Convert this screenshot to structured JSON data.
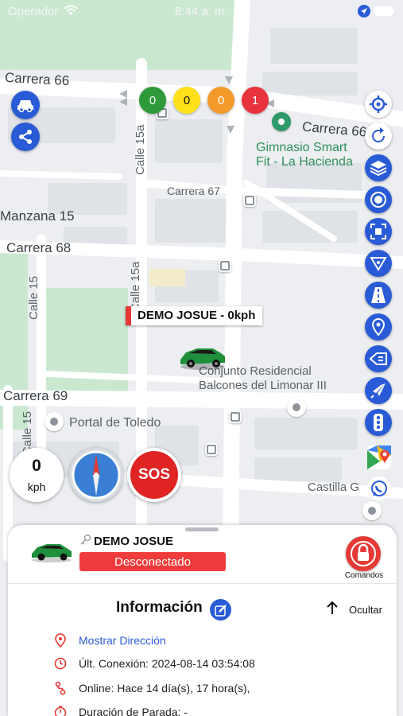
{
  "status_bar": {
    "operator": "Operador",
    "time": "8:44 a. m."
  },
  "map": {
    "streets": {
      "carrera_66_left": "Carrera 66",
      "carrera_66_right": "Carrera 66",
      "carrera_67": "Carrera 67",
      "carrera_68": "Carrera 68",
      "carrera_69": "Carrera 69",
      "calle_15a_top": "Calle 15a",
      "calle_15a_mid": "Calle 15a",
      "calle_15_left": "Calle 15",
      "calle_15_bottom": "Calle 15",
      "manzana_15": "Manzana 15"
    },
    "places": {
      "gym_line1": "Gimnasio Smart",
      "gym_line2": "Fit - La Hacienda",
      "conjunto_line1": "Conjunto Residencial",
      "conjunto_line2": "Balcones del Limonar III",
      "portal": "Portal de Toledo",
      "castilla": "Castilla G"
    }
  },
  "status_counters": [
    {
      "value": "0",
      "color": "#2e9a3a"
    },
    {
      "value": "0",
      "color": "#ffe11a"
    },
    {
      "value": "0",
      "color": "#f39a2b"
    },
    {
      "value": "1",
      "color": "#e8323c"
    }
  ],
  "vehicle_marker": {
    "label": "DEMO JOSUE - 0kph"
  },
  "speed": {
    "value": "0",
    "unit": "kph"
  },
  "sos": {
    "label": "SOS"
  },
  "panel": {
    "device_name": "DEMO JOSUE",
    "status": "Desconectado",
    "commands_label": "Comandos",
    "info_title": "Información",
    "hide_label": "Ocultar",
    "show_address": "Mostrar Dirección",
    "last_connection": "Últ. Conexión: 2024-08-14 03:54:08",
    "online": "Online: Hace 14 día(s), 17 hora(s),",
    "stop_duration": "Duración de Parada: -"
  },
  "colors": {
    "accent_blue": "#2a5bd7",
    "danger_red": "#e53935",
    "link_blue": "#2a5bd7",
    "icon_red": "#e53935"
  }
}
